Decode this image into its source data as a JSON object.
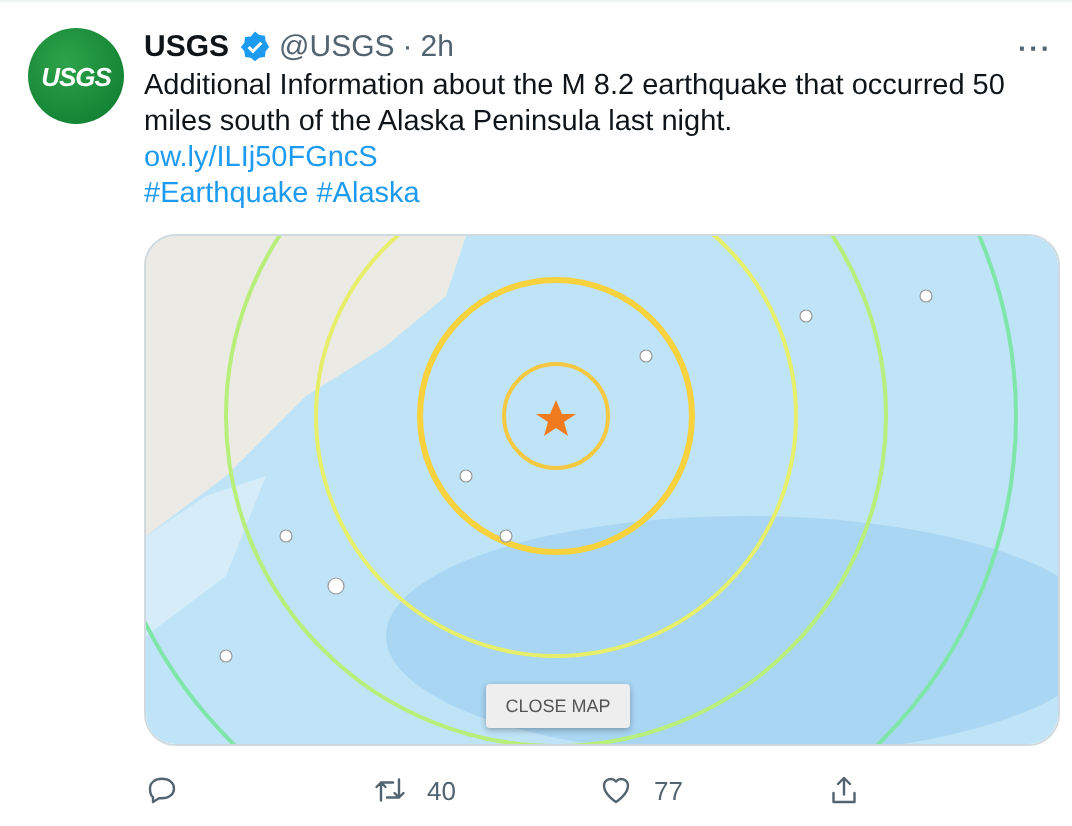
{
  "tweet": {
    "avatar_logo": "USGS",
    "author": "USGS",
    "verified": true,
    "handle": "@USGS",
    "separator": "·",
    "time": "2h",
    "more": "···",
    "text": "Additional Information about the M 8.2 earthquake that occurred 50 miles south of the Alaska Peninsula last night.",
    "link": "ow.ly/ILIj50FGncS",
    "hashtags": [
      "#Earthquake",
      "#Alaska"
    ],
    "media": {
      "kind": "picture",
      "button": "CLOSE MAP"
    },
    "actions": [
      {
        "kind": "reply"
      },
      {
        "kind": "retweet",
        "count": "40"
      },
      {
        "kind": "like",
        "count": "77"
      },
      {
        "kind": "share"
      }
    ]
  }
}
